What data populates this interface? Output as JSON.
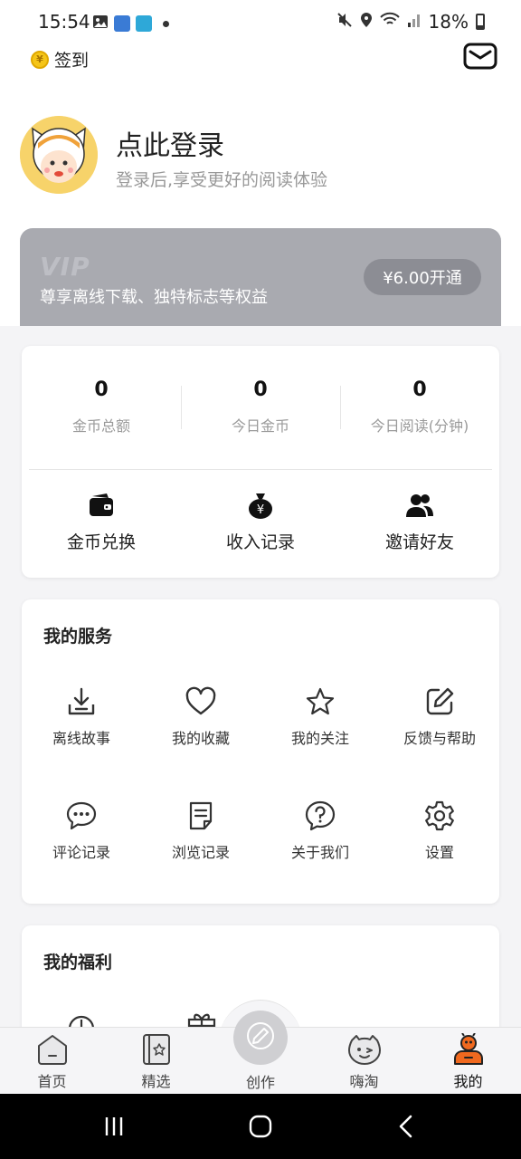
{
  "status_bar": {
    "time": "15:54",
    "battery": "18%",
    "icons": [
      "gallery-icon",
      "calendar-app-icon",
      "snowflake-app-icon",
      "dot-icon",
      "mute-icon",
      "location-icon",
      "wifi-icon",
      "signal-icon",
      "battery-icon"
    ]
  },
  "header": {
    "checkin_label": "签到",
    "coin_glyph": "¥"
  },
  "profile": {
    "title": "点此登录",
    "subtitle": "登录后,享受更好的阅读体验"
  },
  "vip": {
    "logo": "VIP",
    "description": "尊享离线下载、独特标志等权益",
    "button": "¥6.00开通"
  },
  "stats": [
    {
      "value": "0",
      "label": "金币总额"
    },
    {
      "value": "0",
      "label": "今日金币"
    },
    {
      "value": "0",
      "label": "今日阅读(分钟)"
    }
  ],
  "actions": [
    {
      "label": "金币兑换",
      "icon": "wallet-icon"
    },
    {
      "label": "收入记录",
      "icon": "money-bag-icon"
    },
    {
      "label": "邀请好友",
      "icon": "users-icon"
    }
  ],
  "services": {
    "title": "我的服务",
    "items": [
      {
        "label": "离线故事",
        "icon": "download-icon"
      },
      {
        "label": "我的收藏",
        "icon": "heart-icon"
      },
      {
        "label": "我的关注",
        "icon": "star-icon"
      },
      {
        "label": "反馈与帮助",
        "icon": "edit-icon"
      },
      {
        "label": "评论记录",
        "icon": "comment-icon"
      },
      {
        "label": "浏览记录",
        "icon": "document-icon"
      },
      {
        "label": "关于我们",
        "icon": "question-icon"
      },
      {
        "label": "设置",
        "icon": "gear-icon"
      }
    ]
  },
  "welfare": {
    "title": "我的福利"
  },
  "tabs": [
    {
      "label": "首页",
      "icon": "home-icon"
    },
    {
      "label": "精选",
      "icon": "book-icon"
    },
    {
      "label": "创作",
      "icon": "pencil-icon"
    },
    {
      "label": "嗨淘",
      "icon": "wink-face-icon"
    },
    {
      "label": "我的",
      "icon": "profile-icon",
      "active": true
    }
  ],
  "colors": {
    "vip_bg": "#a9aab0",
    "vip_button": "#8c8d94",
    "accent_orange": "#f0691f",
    "avatar_bg": "#f7d36a"
  }
}
